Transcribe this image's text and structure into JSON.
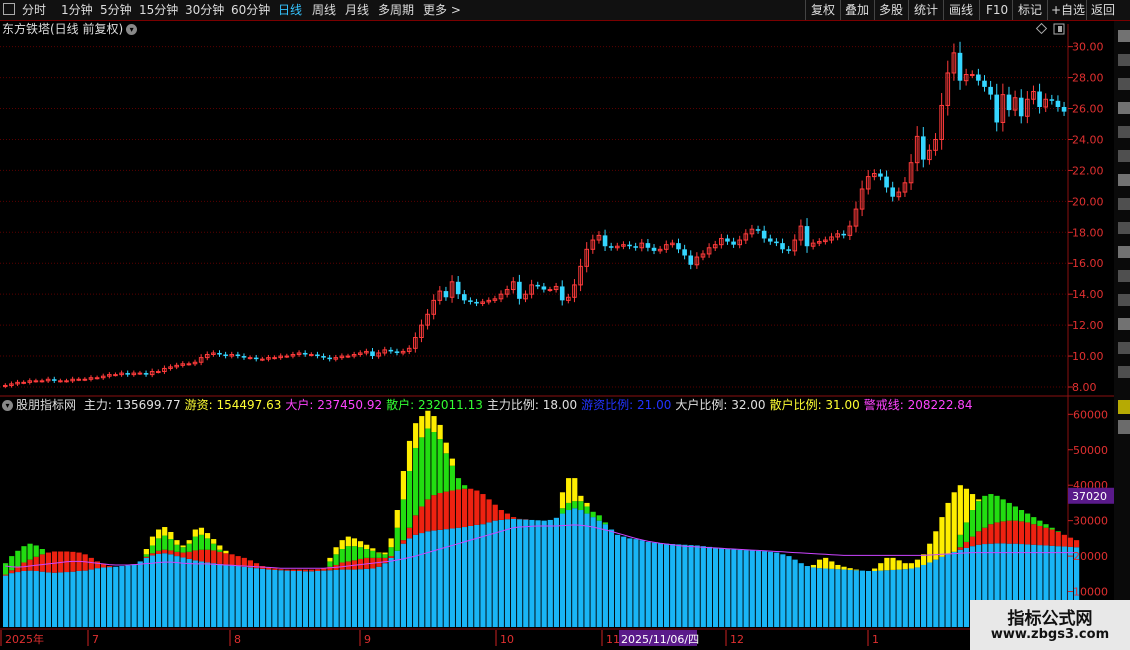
{
  "toolbar": {
    "left_tabs": [
      "分时",
      "1分钟",
      "5分钟",
      "15分钟",
      "30分钟",
      "60分钟",
      "日线",
      "周线",
      "月线",
      "多周期",
      "更多"
    ],
    "active_tab": "日线",
    "right_buttons": [
      "复权",
      "叠加",
      "多股",
      "统计",
      "画线",
      "F10",
      "标记",
      "+自选",
      "返回"
    ]
  },
  "main_chart": {
    "title": "东方铁塔(日线 前复权)",
    "price_ticks": [
      "30.00",
      "28.00",
      "26.00",
      "24.00",
      "22.00",
      "20.00",
      "18.00",
      "16.00",
      "14.00",
      "12.00",
      "10.00",
      "8.00"
    ]
  },
  "indicator": {
    "name": "股朋指标网",
    "items": [
      {
        "label": "主力",
        "value": "135699.77",
        "color": "#e0e0e0"
      },
      {
        "label": "游资",
        "value": "154497.63",
        "color": "#ffff33"
      },
      {
        "label": "大户",
        "value": "237450.92",
        "color": "#ff44ff"
      },
      {
        "label": "散户",
        "value": "232011.13",
        "color": "#33ff33"
      },
      {
        "label": "主力比例",
        "value": "18.00",
        "color": "#e0e0e0"
      },
      {
        "label": "游资比例",
        "value": "21.00",
        "color": "#2233ff"
      },
      {
        "label": "大户比例",
        "value": "32.00",
        "color": "#e0e0e0"
      },
      {
        "label": "散户比例",
        "value": "31.00",
        "color": "#ffff33"
      },
      {
        "label": "警戒线",
        "value": "208222.84",
        "color": "#ff44ff"
      }
    ],
    "y_ticks": [
      "60000",
      "50000",
      "40000",
      "30000",
      "20000",
      "10000"
    ],
    "current_label": "37020"
  },
  "x_axis": {
    "labels": [
      "2025年",
      "7",
      "8",
      "9",
      "10",
      "11",
      "2025/11/06/四",
      "12",
      "1"
    ]
  },
  "watermark": {
    "line1": "指标公式网",
    "line2": "www.zbgs3.com"
  },
  "colors": {
    "up": "#ff3b3b",
    "down": "#35d6ff",
    "grid": "#5a0000",
    "cyan": "#19b5f5",
    "red": "#ee2211",
    "green": "#22dd11",
    "yellow": "#ffee00",
    "purple": "#cc44ff"
  },
  "chart_data": [
    {
      "type": "candlestick",
      "title": "东方铁塔(日线 前复权)",
      "ylim": [
        7.2,
        30.8
      ],
      "closes": [
        8.1,
        8.2,
        8.3,
        8.3,
        8.4,
        8.4,
        8.4,
        8.5,
        8.4,
        8.4,
        8.4,
        8.5,
        8.5,
        8.5,
        8.6,
        8.6,
        8.7,
        8.8,
        8.8,
        8.9,
        8.8,
        8.9,
        8.9,
        8.8,
        9.0,
        9.0,
        9.2,
        9.3,
        9.4,
        9.5,
        9.5,
        9.6,
        9.9,
        10.1,
        10.2,
        10.1,
        10.0,
        10.1,
        10.0,
        9.9,
        9.9,
        9.8,
        9.8,
        9.9,
        9.9,
        10.0,
        10.0,
        10.1,
        10.2,
        10.1,
        10.1,
        10.0,
        9.9,
        9.8,
        9.9,
        10.0,
        10.0,
        10.1,
        10.2,
        10.3,
        10.0,
        10.2,
        10.4,
        10.3,
        10.2,
        10.3,
        10.5,
        11.2,
        12.0,
        12.7,
        13.6,
        14.2,
        13.8,
        14.8,
        14.0,
        13.6,
        13.5,
        13.4,
        13.5,
        13.6,
        13.7,
        14.0,
        14.3,
        14.8,
        13.7,
        14.0,
        14.6,
        14.5,
        14.3,
        14.3,
        14.5,
        13.6,
        13.8,
        14.6,
        15.8,
        16.9,
        17.5,
        17.8,
        17.1,
        17.0,
        17.1,
        17.2,
        17.1,
        17.0,
        17.3,
        17.0,
        16.8,
        16.9,
        17.2,
        17.3,
        16.9,
        16.5,
        15.9,
        16.4,
        16.6,
        17.0,
        17.2,
        17.6,
        17.4,
        17.2,
        17.5,
        17.9,
        18.2,
        18.1,
        17.6,
        17.4,
        17.3,
        16.9,
        16.8,
        17.5,
        18.4,
        17.1,
        17.3,
        17.4,
        17.5,
        17.7,
        17.9,
        17.8,
        18.4,
        19.5,
        20.8,
        21.6,
        21.8,
        21.6,
        20.9,
        20.3,
        20.6,
        21.2,
        22.5,
        24.2,
        22.7,
        23.3,
        24.0,
        26.2,
        28.3,
        29.6,
        27.8,
        28.2,
        28.2,
        27.8,
        27.4,
        26.9,
        25.1,
        26.9,
        25.9,
        26.7,
        25.5,
        26.6,
        27.1,
        26.1,
        26.6,
        26.5,
        26.1,
        25.8
      ],
      "x_labels": [
        "2025年",
        "7",
        "8",
        "9",
        "10",
        "11",
        "12",
        "1"
      ]
    },
    {
      "type": "bar",
      "stacked": true,
      "ylim": [
        0,
        64000
      ],
      "series": [
        {
          "name": "主力",
          "color": "#19b5f5"
        },
        {
          "name": "大户",
          "color": "#ee2211"
        },
        {
          "name": "散户",
          "color": "#22dd11"
        },
        {
          "name": "游资",
          "color": "#ffee00"
        },
        {
          "name": "警戒线",
          "color": "#cc44ff",
          "type": "line"
        }
      ],
      "primary_values": [
        14500,
        15200,
        15500,
        15800,
        15900,
        15800,
        15600,
        15400,
        15300,
        15400,
        15500,
        15600,
        15800,
        15900,
        16200,
        16600,
        16800,
        16900,
        17000,
        17200,
        17400,
        17700,
        18500,
        19500,
        20200,
        20600,
        20800,
        20500,
        20000,
        19600,
        19200,
        18800,
        18500,
        18200,
        18000,
        17800,
        17600,
        17400,
        17200,
        17000,
        16800,
        16600,
        16400,
        16200,
        16100,
        16000,
        15900,
        15800,
        15800,
        15700,
        15700,
        15800,
        15900,
        16000,
        16100,
        16200,
        16200,
        16200,
        16300,
        16400,
        16500,
        17000,
        18000,
        19500,
        21500,
        23500,
        25000,
        26000,
        26500,
        27000,
        27200,
        27400,
        27600,
        27800,
        28000,
        28200,
        28500,
        28800,
        29000,
        29500,
        30000,
        30200,
        30400,
        30500,
        30400,
        30300,
        30200,
        30100,
        30000,
        30200,
        30800,
        32000,
        33000,
        33500,
        33000,
        32000,
        31000,
        30000,
        29000,
        27500,
        26000,
        25500,
        25000,
        24800,
        24500,
        24000,
        23800,
        23600,
        23500,
        23400,
        23300,
        23200,
        23100,
        23000,
        22800,
        22600,
        22400,
        22200,
        22000,
        21900,
        21800,
        21700,
        21600,
        21500,
        21400,
        21200,
        21000,
        20500,
        20000,
        19000,
        18000,
        17200,
        16800,
        16600,
        16500,
        16400,
        16300,
        16200,
        16100,
        16000,
        15900,
        15800,
        15800,
        15900,
        16000,
        16100,
        16200,
        16300,
        16500,
        16800,
        17500,
        18200,
        19000,
        19800,
        20500,
        21200,
        21800,
        22300,
        22800,
        23200,
        23400,
        23500,
        23600,
        23600,
        23500,
        23500,
        23400,
        23300,
        23200,
        23100,
        23000,
        22900,
        22800,
        22700,
        22600,
        22500
      ],
      "secondary_values": [
        14800,
        16000,
        17000,
        18200,
        19000,
        19800,
        20500,
        21000,
        21300,
        21300,
        21300,
        21200,
        21000,
        20500,
        19500,
        18500,
        17800,
        17200,
        17000,
        17200,
        17400,
        17700,
        18500,
        19800,
        20800,
        21500,
        21800,
        21600,
        21200,
        21000,
        21200,
        21600,
        21800,
        21800,
        21600,
        21200,
        20800,
        20500,
        20000,
        19500,
        18800,
        18000,
        17200,
        16800,
        16500,
        16300,
        16200,
        16200,
        16200,
        16200,
        16200,
        16300,
        16500,
        17000,
        17500,
        18200,
        18500,
        18800,
        19200,
        19500,
        19500,
        19500,
        19500,
        20000,
        21500,
        24500,
        28000,
        31500,
        34000,
        36000,
        37200,
        37800,
        38200,
        38500,
        38800,
        39000,
        39000,
        38500,
        37500,
        36000,
        34500,
        33000,
        32000,
        31000,
        30500,
        30400,
        30200,
        30100,
        30000,
        30200,
        30800,
        32000,
        33000,
        33500,
        33000,
        32000,
        31000,
        30000,
        29000,
        27500,
        26000,
        25500,
        25000,
        24800,
        24500,
        24000,
        23800,
        23600,
        23500,
        23400,
        23300,
        23200,
        23100,
        23000,
        22800,
        22600,
        22400,
        22200,
        22000,
        21900,
        21800,
        21700,
        21600,
        21500,
        21400,
        21200,
        21000,
        20500,
        20000,
        19000,
        18000,
        17200,
        16800,
        16600,
        16500,
        16400,
        16300,
        16200,
        16100,
        16000,
        15900,
        15800,
        15800,
        15900,
        16000,
        16100,
        16200,
        16300,
        16500,
        16800,
        17500,
        18200,
        19000,
        19800,
        20500,
        21200,
        22500,
        24000,
        25500,
        27000,
        28000,
        29000,
        29500,
        29800,
        30000,
        30000,
        29800,
        29500,
        29000,
        28500,
        28000,
        27500,
        26800,
        26000,
        25200,
        24500
      ],
      "tertiary_values": [
        18000,
        20000,
        21500,
        22800,
        23500,
        23000,
        22000,
        21000,
        21300,
        21300,
        21300,
        21200,
        21000,
        20500,
        19500,
        18500,
        17800,
        17200,
        17000,
        17200,
        17400,
        17700,
        18500,
        20500,
        23000,
        25000,
        25800,
        24800,
        23200,
        22500,
        23500,
        25500,
        26000,
        25000,
        23500,
        21800,
        20800,
        20500,
        20000,
        19500,
        18800,
        18000,
        17200,
        16800,
        16500,
        16300,
        16200,
        16200,
        16200,
        16200,
        16200,
        16300,
        16500,
        18500,
        20500,
        22000,
        22800,
        22800,
        22500,
        22000,
        21500,
        20800,
        20500,
        22500,
        28000,
        36000,
        44000,
        50500,
        53500,
        56000,
        55000,
        53000,
        49000,
        45500,
        42000,
        40000,
        39000,
        38500,
        37500,
        36000,
        34500,
        33000,
        32000,
        31000,
        30500,
        30400,
        30200,
        30100,
        30000,
        30200,
        30800,
        33500,
        35000,
        35500,
        35500,
        34000,
        32500,
        31500,
        29500,
        27500,
        26000,
        25500,
        25000,
        24800,
        24500,
        24000,
        23800,
        23600,
        23500,
        23400,
        23300,
        23200,
        23100,
        23000,
        22800,
        22600,
        22400,
        22200,
        22000,
        21900,
        21800,
        21700,
        21600,
        21500,
        21400,
        21200,
        21000,
        20500,
        20000,
        19000,
        18000,
        17200,
        16800,
        16600,
        16500,
        16400,
        16300,
        16200,
        16100,
        16000,
        15900,
        15800,
        15800,
        15900,
        16000,
        16100,
        16200,
        16300,
        16500,
        16800,
        17500,
        18200,
        19000,
        19800,
        20500,
        21200,
        26000,
        29500,
        33000,
        35500,
        37000,
        37500,
        37000,
        36000,
        35000,
        34000,
        33000,
        32000,
        31000,
        30000,
        29000,
        28000,
        27000,
        26000,
        25200,
        24500
      ],
      "total_values": [
        18000,
        20000,
        21500,
        22800,
        23500,
        23000,
        22000,
        21000,
        21300,
        21300,
        21300,
        21200,
        21000,
        20500,
        19500,
        18500,
        17800,
        17200,
        17000,
        17200,
        17400,
        17700,
        18500,
        22000,
        25500,
        27500,
        28200,
        26800,
        24500,
        23000,
        24500,
        27500,
        28000,
        26500,
        24800,
        23000,
        21500,
        20500,
        20000,
        19500,
        18800,
        18000,
        17200,
        16800,
        16500,
        16300,
        16200,
        16200,
        16200,
        16200,
        16200,
        16300,
        16500,
        19500,
        22500,
        24500,
        25500,
        25000,
        24200,
        23200,
        22200,
        21000,
        21000,
        25000,
        33000,
        44000,
        52500,
        57500,
        59500,
        61000,
        59500,
        57000,
        52000,
        47500,
        42000,
        40000,
        39000,
        38500,
        37500,
        36000,
        34500,
        33000,
        32000,
        31000,
        30500,
        30400,
        30200,
        30100,
        30000,
        30200,
        30800,
        38000,
        42000,
        42000,
        37000,
        35000,
        32500,
        31500,
        29500,
        27500,
        26000,
        25500,
        25000,
        24800,
        24500,
        24000,
        23800,
        23600,
        23500,
        23400,
        23300,
        23200,
        23100,
        23000,
        22800,
        22600,
        22400,
        22200,
        22000,
        21900,
        21800,
        21700,
        21600,
        21500,
        21400,
        21200,
        21000,
        20500,
        20000,
        19000,
        18000,
        17200,
        17500,
        19000,
        19500,
        18500,
        17500,
        17000,
        16600,
        16200,
        15900,
        15800,
        16500,
        18000,
        19500,
        19500,
        18800,
        18000,
        18000,
        19000,
        20500,
        23500,
        27000,
        31000,
        35000,
        38000,
        40000,
        39000,
        37500,
        36000,
        35000,
        34000,
        33000,
        32000,
        31000,
        30000,
        29000,
        28000,
        27000,
        26000,
        25200,
        24500
      ],
      "alert_line": [
        17200,
        17000,
        16900,
        17000,
        17200,
        17400,
        17600,
        17800,
        18000,
        18200,
        18400,
        18500,
        18500,
        18400,
        18200,
        18000,
        17800,
        17600,
        17500,
        17500,
        17500,
        17600,
        17700,
        17900,
        18000,
        18200,
        18300,
        18300,
        18200,
        18000,
        17900,
        17800,
        17800,
        17800,
        17700,
        17600,
        17500,
        17400,
        17300,
        17200,
        17100,
        17000,
        16900,
        16800,
        16700,
        16600,
        16600,
        16600,
        16600,
        16600,
        16600,
        16600,
        16600,
        16700,
        16800,
        17000,
        17200,
        17400,
        17600,
        17800,
        18000,
        18200,
        18400,
        18600,
        18900,
        19200,
        19600,
        20000,
        20500,
        21000,
        21500,
        22000,
        22500,
        23000,
        23500,
        24000,
        24500,
        25000,
        25500,
        26000,
        26500,
        27000,
        27500,
        28000,
        28200,
        28300,
        28400,
        28500,
        28500,
        28500,
        28500,
        28600,
        28700,
        28800,
        28700,
        28500,
        28200,
        27800,
        27400,
        27000,
        26500,
        26000,
        25500,
        25000,
        24600,
        24200,
        23900,
        23600,
        23400,
        23200,
        23000,
        22800,
        22700,
        22600,
        22500,
        22400,
        22300,
        22200,
        22100,
        22000,
        21900,
        21800,
        21700,
        21600,
        21500,
        21400,
        21300,
        21200,
        21100,
        21000,
        20900,
        20800,
        20700,
        20600,
        20500,
        20400,
        20300,
        20200,
        20200,
        20200,
        20200,
        20200,
        20200,
        20200,
        20200,
        20200,
        20200,
        20200,
        20200,
        20200,
        20200,
        20300,
        20400,
        20500,
        20600,
        20700,
        20800,
        20900,
        21000,
        21000,
        21000,
        21000,
        21000,
        21000,
        21000,
        21000,
        21000,
        21000,
        21000,
        21000,
        21000,
        21000,
        21000,
        21000,
        21000,
        21000
      ]
    }
  ]
}
